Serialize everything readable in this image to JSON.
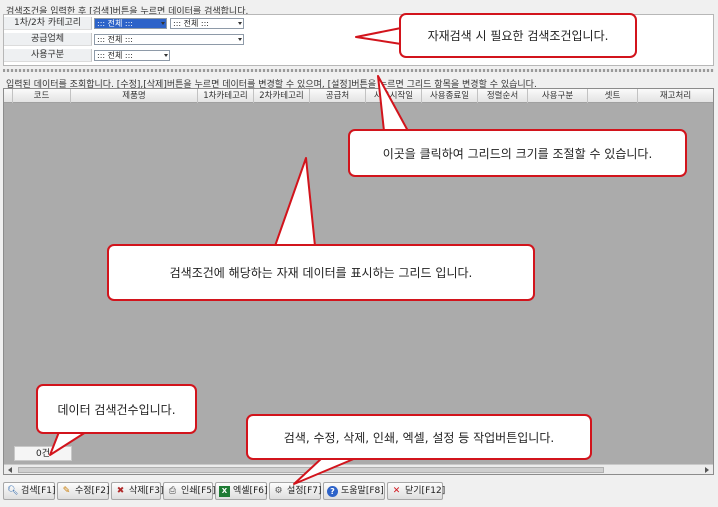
{
  "hints": {
    "search": "검색조건을 입력한 후 [검색]버튼을 누르면 데이터를 검색합니다.",
    "grid": "입력된 데이터를 조회합니다. [수정],[삭제]버튼을 누르면 데이터를 변경할 수 있으며, [설정]버튼을 누르면 그리드 항목을 변경할 수 있습니다."
  },
  "conditions": {
    "category": {
      "label": "1차/2차 카테고리",
      "value1": "::: 전체 :::",
      "value2": "::: 전체 :::"
    },
    "supplier": {
      "label": "공급업체",
      "value": "::: 전체 :::"
    },
    "usage": {
      "label": "사용구분",
      "value": "::: 전체 :::"
    }
  },
  "grid": {
    "columns": [
      "코드",
      "제품명",
      "1차카테고리",
      "2차카테고리",
      "공급처",
      "사용시작일",
      "사용종료일",
      "정렬순서",
      "사용구분",
      "셋트",
      "재고처리"
    ],
    "count": "0건"
  },
  "toolbar": [
    {
      "icon": "search-icon",
      "label": "검색[F1]"
    },
    {
      "icon": "edit-icon",
      "label": "수정[F2]"
    },
    {
      "icon": "delete-icon",
      "label": "삭제[F3]"
    },
    {
      "icon": "print-icon",
      "label": "인쇄[F5]"
    },
    {
      "icon": "excel-icon",
      "label": "엑셀[F6]"
    },
    {
      "icon": "gear-icon",
      "label": "설정[F7]"
    },
    {
      "icon": "help-icon",
      "label": "도움말[F8]"
    },
    {
      "icon": "close-icon",
      "label": "닫기[F12]"
    }
  ],
  "callouts": {
    "conditions": "자재검색 시 필요한 검색조건입니다.",
    "resize": "이곳을 클릭하여 그리드의 크기를 조절할 수 있습니다.",
    "grid": "검색조건에 해당하는 자재 데이터를 표시하는 그리드 입니다.",
    "count": "데이터 검색건수입니다.",
    "buttons": "검색, 수정, 삭제, 인쇄, 엑셀, 설정 등 작업버튼입니다."
  },
  "colors": {
    "callout_border": "#d2141c",
    "selected_combo": "#2d63c9",
    "grid_background": "#ababab"
  }
}
